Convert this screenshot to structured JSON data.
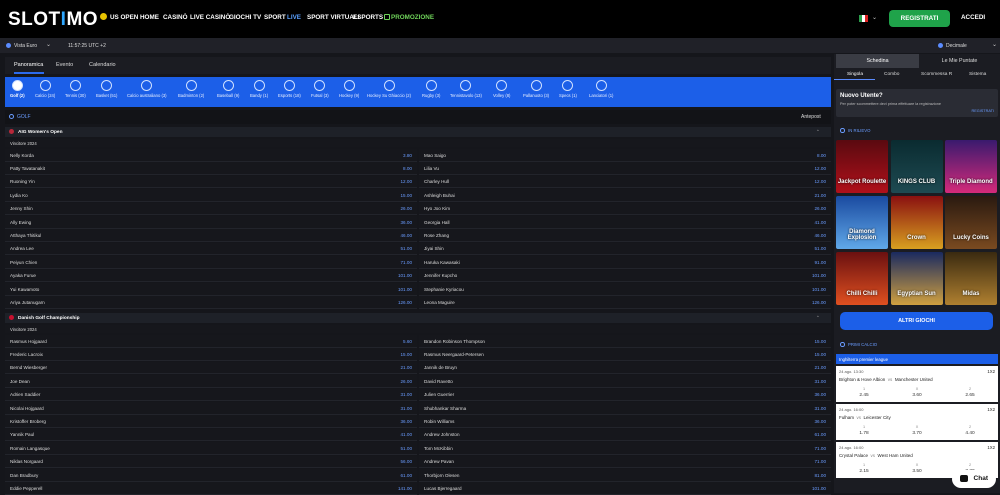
{
  "header": {
    "logo_left": "SLOT",
    "logo_o": "I",
    "logo_right": "MO",
    "nav": [
      "US OPEN",
      "HOME",
      "CASINÒ",
      "LIVE CASINÒ",
      "GIOCHI TV",
      "SPORT",
      "LIVE",
      "SPORT VIRTUALI",
      "ESPORTS",
      "PROMOZIONE"
    ],
    "register": "REGISTRATI",
    "login": "ACCEDI"
  },
  "subbar": {
    "view": "Vista Euro",
    "time": "11:57:25 UTC +2",
    "odds_format": "Decimale"
  },
  "tabs": [
    "Panoramica",
    "Evento",
    "Calendario"
  ],
  "sports": [
    "Golf (2)",
    "Calcio (24)",
    "Tennis (30)",
    "Basket (51)",
    "Calcio australiano (3)",
    "Badminton (2)",
    "Baseball (9)",
    "Bandy (1)",
    "Esports (18)",
    "Futsal (3)",
    "Hockey (9)",
    "Hockey Su Ghiaccio (2)",
    "Rugby (3)",
    "Tennistavolo (13)",
    "Volley (8)",
    "Pallanuoto (3)",
    "Specs (1)",
    "Lanciatori (1)"
  ],
  "golf_header": {
    "title": "GOLF",
    "antepost": "Antepost"
  },
  "events": [
    {
      "title": "AIG Women's Open",
      "winner": "Vincitore 2024",
      "left": [
        [
          "Nelly Korda",
          "3.80"
        ],
        [
          "Patty Tavatanakit",
          "8.00"
        ],
        [
          "Ruoning Yin",
          "12.00"
        ],
        [
          "Lydia Ko",
          "15.00"
        ],
        [
          "Jenny Shin",
          "26.00"
        ],
        [
          "Ally Ewing",
          "36.00"
        ],
        [
          "Atthaya Thitikul",
          "46.00"
        ],
        [
          "Andrea Lee",
          "51.00"
        ],
        [
          "Peiyun Chien",
          "71.00"
        ],
        [
          "Ayaka Furue",
          "101.00"
        ],
        [
          "Yui Kawamoto",
          "101.00"
        ],
        [
          "Ariya Jutanugarn",
          "126.00"
        ]
      ],
      "right": [
        [
          "Mao Saigo",
          "8.00"
        ],
        [
          "Lilia Vu",
          "12.00"
        ],
        [
          "Charley Hull",
          "12.00"
        ],
        [
          "Ashleigh Buhai",
          "21.00"
        ],
        [
          "Hyo Joo Kim",
          "26.00"
        ],
        [
          "Georgia Hall",
          "41.00"
        ],
        [
          "Rose Zhang",
          "46.00"
        ],
        [
          "Jiyai Shin",
          "51.00"
        ],
        [
          "Haruka Kawasaki",
          "91.00"
        ],
        [
          "Jennifer Kupcho",
          "101.00"
        ],
        [
          "Stephanie Kyriacou",
          "101.00"
        ],
        [
          "Leona Maguire",
          "126.00"
        ]
      ]
    },
    {
      "title": "Danish Golf Championship",
      "winner": "Vincitore 2024",
      "left": [
        [
          "Rasmus Hojgaard",
          "5.60"
        ],
        [
          "Frederic Lacroix",
          "15.00"
        ],
        [
          "Bernd Wiesberger",
          "21.00"
        ],
        [
          "Joe Dean",
          "26.00"
        ],
        [
          "Adrien Saddier",
          "31.00"
        ],
        [
          "Nicolai Hojgaard",
          "31.00"
        ],
        [
          "Kristoffer Broberg",
          "36.00"
        ],
        [
          "Yannik Paul",
          "41.00"
        ],
        [
          "Romain Langasque",
          "51.00"
        ],
        [
          "Niklas Norgaard",
          "56.00"
        ],
        [
          "Dan Bradbury",
          "61.00"
        ],
        [
          "Eddie Pepperell",
          "141.00"
        ]
      ],
      "right": [
        [
          "Brandon Robinson Thompson",
          "15.00"
        ],
        [
          "Rasmus Neergaard-Petersen",
          "15.00"
        ],
        [
          "Jannik de Bruyn",
          "21.00"
        ],
        [
          "David Ravetto",
          "31.00"
        ],
        [
          "Julien Guerrier",
          "36.00"
        ],
        [
          "Shubhankar Sharma",
          "31.00"
        ],
        [
          "Robin Williams",
          "36.00"
        ],
        [
          "Andrew Johnston",
          "61.00"
        ],
        [
          "Tom McKibbin",
          "71.00"
        ],
        [
          "Andrew Pavan",
          "71.00"
        ],
        [
          "Thorbjorn Olesen",
          "81.00"
        ],
        [
          "Lucas Bjerregaard",
          "101.00"
        ]
      ]
    }
  ],
  "right": {
    "tabs": [
      "Schedina",
      "Le Mie Puntate"
    ],
    "subtabs": [
      "Singola",
      "Combo",
      "Scommessa R",
      "Sistema"
    ],
    "nuovo_title": "Nuovo Utente?",
    "nuovo_text": "Per poter scommettere devi prima effettuare la registrazione",
    "nuovo_link": "REGISTRATI",
    "inrilievo": "IN RILIEVO",
    "games": [
      "Jackpot Roulette",
      "KINGS CLUB",
      "Triple Diamond",
      "Diamond Explosion",
      "Crown",
      "Lucky Coins",
      "Chilli Chilli",
      "Egyptian Sun",
      "Midas"
    ],
    "altri": "ALTRI GIOCHI",
    "primecalcio": "PRIMI CALCIO",
    "league": "Inghilterra premier league",
    "matches": [
      {
        "date": "24 ago. 13:30",
        "home": "Brighton & Hove Albion",
        "away": "Manchester United",
        "market": "1X2",
        "odds": [
          "2.45",
          "3.60",
          "2.65"
        ]
      },
      {
        "date": "24 ago. 16:00",
        "home": "Fulham",
        "away": "Leicester City",
        "market": "1X2",
        "odds": [
          "1.78",
          "3.70",
          "4.40"
        ]
      },
      {
        "date": "24 ago. 16:00",
        "home": "Crystal Palace",
        "away": "West Ham United",
        "market": "1X2",
        "odds": [
          "2.15",
          "3.50",
          "3.30"
        ]
      }
    ],
    "labels": [
      "1",
      "X",
      "2"
    ],
    "vs": "vs"
  },
  "chat": "Chat"
}
